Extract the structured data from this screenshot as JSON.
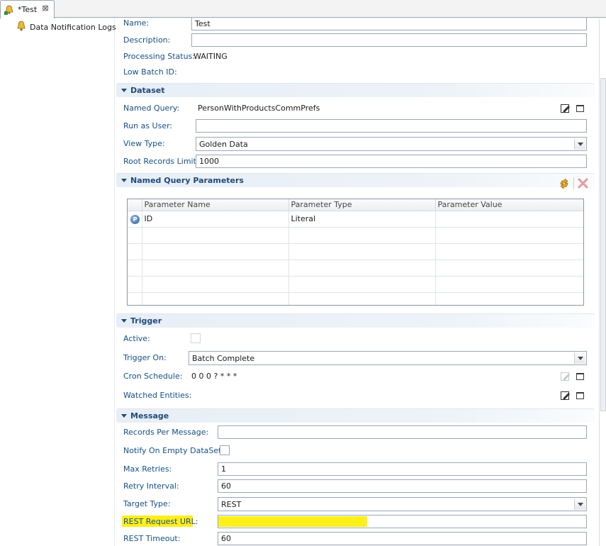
{
  "tab": {
    "title": "*Test"
  },
  "tree": {
    "items": [
      {
        "label": "Data Notification Logs"
      }
    ]
  },
  "general": {
    "name_label": "Name:",
    "name_value": "Test",
    "description_label": "Description:",
    "description_value": "",
    "processing_status_label": "Processing Status:",
    "processing_status_value": "WAITING",
    "low_batch_id_label": "Low Batch ID:",
    "low_batch_id_value": ""
  },
  "dataset": {
    "title": "Dataset",
    "named_query_label": "Named Query:",
    "named_query_value": "PersonWithProductsCommPrefs",
    "run_as_user_label": "Run as User:",
    "run_as_user_value": "",
    "view_type_label": "View Type:",
    "view_type_value": "Golden Data",
    "root_records_limit_label": "Root Records Limit:",
    "root_records_limit_value": "1000"
  },
  "params": {
    "title": "Named Query Parameters",
    "columns": [
      "Parameter Name",
      "Parameter Type",
      "Parameter Value"
    ],
    "rows": [
      {
        "badge": "P",
        "name": "ID",
        "type": "Literal",
        "value": ""
      }
    ]
  },
  "trigger": {
    "title": "Trigger",
    "active_label": "Active:",
    "active_checked": false,
    "trigger_on_label": "Trigger On:",
    "trigger_on_value": "Batch Complete",
    "cron_schedule_label": "Cron Schedule:",
    "cron_schedule_value": "0 0 0 ? * * *",
    "watched_entities_label": "Watched Entities:"
  },
  "message": {
    "title": "Message",
    "records_per_message_label": "Records Per Message:",
    "records_per_message_value": "",
    "notify_on_empty_label": "Notify On Empty DataSet:",
    "notify_on_empty_checked": false,
    "max_retries_label": "Max Retries:",
    "max_retries_value": "1",
    "retry_interval_label": "Retry Interval:",
    "retry_interval_value": "60",
    "target_type_label": "Target Type:",
    "target_type_value": "REST",
    "rest_request_url_label": "REST Request URL:",
    "rest_request_url_value": "",
    "rest_timeout_label": "REST Timeout:",
    "rest_timeout_value": "60"
  },
  "colors": {
    "label_blue": "#164f86",
    "section_title": "#1f4a7a",
    "highlight_yellow": "#ffef1a"
  }
}
